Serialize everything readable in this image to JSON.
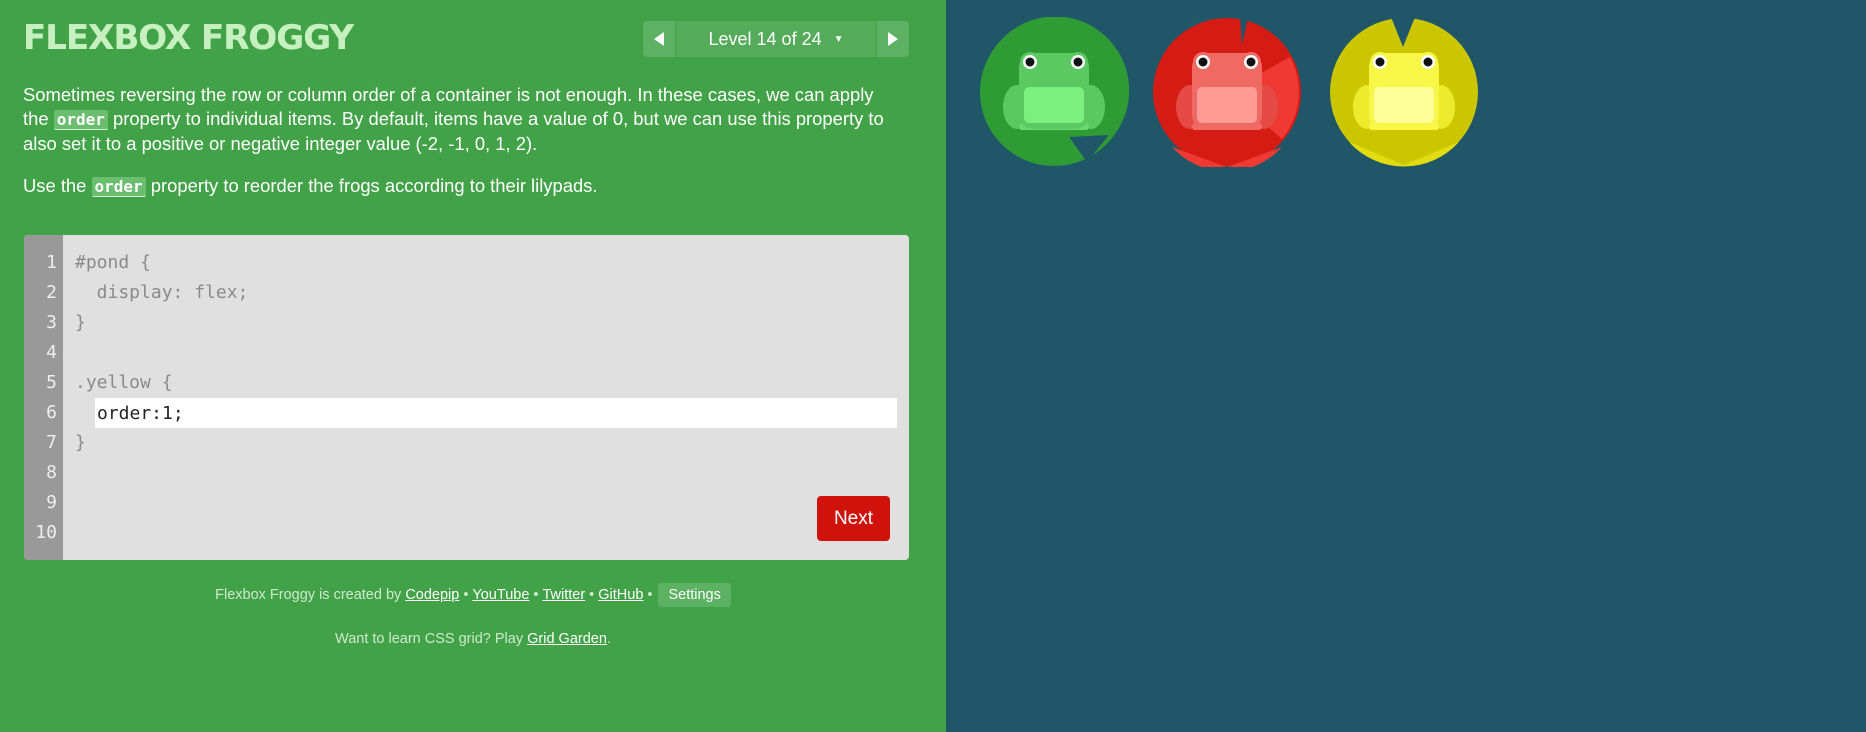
{
  "app": {
    "logo": "FLEXBOX FROGGY"
  },
  "level_nav": {
    "label": "Level 14 of 24",
    "prev_icon": "triangle-left-icon",
    "next_icon": "triangle-right-icon"
  },
  "instructions": {
    "p1_before": "Sometimes reversing the row or column order of a container is not enough. In these cases, we can apply the ",
    "p1_code": "order",
    "p1_after": " property to individual items. By default, items have a value of 0, but we can use this property to also set it to a positive or negative integer value (-2, -1, 0, 1, 2).",
    "p2_before": "Use the ",
    "p2_code": "order",
    "p2_after": " property to reorder the frogs according to their lilypads."
  },
  "editor": {
    "line_numbers": [
      "1",
      "2",
      "3",
      "4",
      "5",
      "6",
      "7",
      "8",
      "9",
      "10"
    ],
    "lines": [
      "#pond {",
      "  display: flex;",
      "}",
      "",
      ".yellow {",
      "",
      "}",
      "",
      "",
      ""
    ],
    "input_value": "order:1;",
    "next_label": "Next"
  },
  "footer": {
    "created_by": "Flexbox Froggy is created by ",
    "links": [
      "Codepip",
      "YouTube",
      "Twitter",
      "GitHub"
    ],
    "separator": "•",
    "settings_label": "Settings",
    "promo_text": "Want to learn CSS grid? Play ",
    "promo_link": "Grid Garden",
    "promo_end": "."
  },
  "colors": {
    "sidebar_bg": "#42a248",
    "pond_bg": "#1f5768",
    "next_button": "#d0120c",
    "green_pad": "#2f9b34",
    "red_pad": "#d41b14",
    "yellow_pad": "#cbc600"
  },
  "lilypads": [
    {
      "color": "green",
      "icon": "green-frog-icon"
    },
    {
      "color": "red",
      "icon": "red-frog-icon"
    },
    {
      "color": "yellow",
      "icon": "yellow-frog-icon"
    }
  ]
}
